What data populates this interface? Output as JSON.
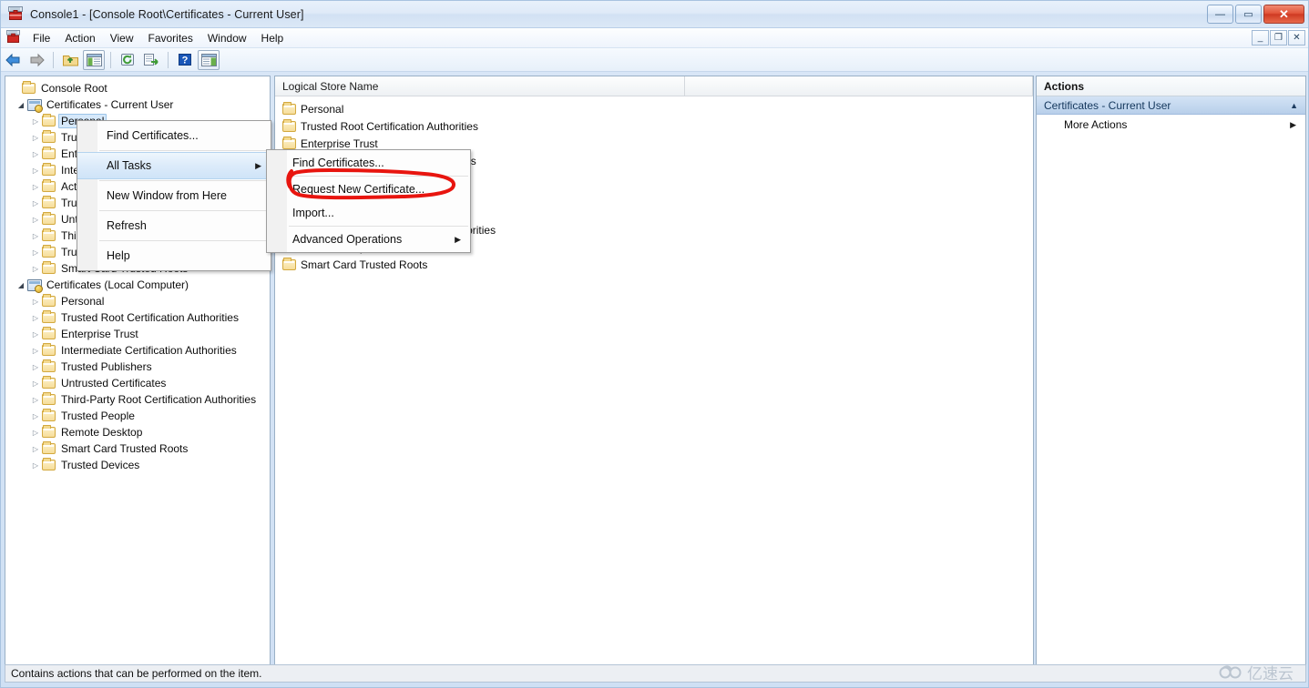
{
  "window": {
    "title": "Console1 - [Console Root\\Certificates - Current User]",
    "app_icon": "mmc-console-icon",
    "buttons": {
      "minimize": "—",
      "maximize": "▭",
      "close": "✕"
    },
    "mdi_buttons": {
      "minimize": "_",
      "restore": "❐",
      "close": "✕"
    }
  },
  "menubar": {
    "items": [
      {
        "label": "File"
      },
      {
        "label": "Action"
      },
      {
        "label": "View"
      },
      {
        "label": "Favorites"
      },
      {
        "label": "Window"
      },
      {
        "label": "Help"
      }
    ]
  },
  "toolbar": {
    "items": [
      {
        "name": "back-icon"
      },
      {
        "name": "forward-icon"
      },
      {
        "name": "up-folder-icon"
      },
      {
        "name": "show-hide-tree-icon"
      },
      {
        "name": "refresh-icon"
      },
      {
        "name": "export-list-icon"
      },
      {
        "name": "help-icon"
      },
      {
        "name": "show-hide-action-pane-icon"
      }
    ]
  },
  "tree": {
    "nodes": [
      {
        "label": "Console Root",
        "level": 0,
        "icon": "folder-icon",
        "twisty": "",
        "selected": false
      },
      {
        "label": "Certificates - Current User",
        "level": 1,
        "icon": "snapin-icon",
        "twisty": "open",
        "selected": false
      },
      {
        "label": "Personal",
        "level": 2,
        "icon": "folder-icon",
        "twisty": "closed",
        "selected": true
      },
      {
        "label": "Trusted Root Certification Authorities",
        "level": 2,
        "icon": "folder-icon",
        "twisty": "closed",
        "selected": false
      },
      {
        "label": "Enterprise Trust",
        "level": 2,
        "icon": "folder-icon",
        "twisty": "closed",
        "selected": false
      },
      {
        "label": "Intermediate Certification Authorities",
        "level": 2,
        "icon": "folder-icon",
        "twisty": "closed",
        "selected": false
      },
      {
        "label": "Active Directory User Object",
        "level": 2,
        "icon": "folder-icon",
        "twisty": "closed",
        "selected": false
      },
      {
        "label": "Trusted Publishers",
        "level": 2,
        "icon": "folder-icon",
        "twisty": "closed",
        "selected": false
      },
      {
        "label": "Untrusted Certificates",
        "level": 2,
        "icon": "folder-icon",
        "twisty": "closed",
        "selected": false
      },
      {
        "label": "Third-Party Root Certification Authorities",
        "level": 2,
        "icon": "folder-icon",
        "twisty": "closed",
        "selected": false
      },
      {
        "label": "Trusted People",
        "level": 2,
        "icon": "folder-icon",
        "twisty": "closed",
        "selected": false
      },
      {
        "label": "Smart Card Trusted Roots",
        "level": 2,
        "icon": "folder-icon",
        "twisty": "closed",
        "selected": false
      },
      {
        "label": "Certificates (Local Computer)",
        "level": 1,
        "icon": "snapin-icon",
        "twisty": "open",
        "selected": false
      },
      {
        "label": "Personal",
        "level": 2,
        "icon": "folder-icon",
        "twisty": "closed",
        "selected": false
      },
      {
        "label": "Trusted Root Certification Authorities",
        "level": 2,
        "icon": "folder-icon",
        "twisty": "closed",
        "selected": false
      },
      {
        "label": "Enterprise Trust",
        "level": 2,
        "icon": "folder-icon",
        "twisty": "closed",
        "selected": false
      },
      {
        "label": "Intermediate Certification Authorities",
        "level": 2,
        "icon": "folder-icon",
        "twisty": "closed",
        "selected": false
      },
      {
        "label": "Trusted Publishers",
        "level": 2,
        "icon": "folder-icon",
        "twisty": "closed",
        "selected": false
      },
      {
        "label": "Untrusted Certificates",
        "level": 2,
        "icon": "folder-icon",
        "twisty": "closed",
        "selected": false
      },
      {
        "label": "Third-Party Root Certification Authorities",
        "level": 2,
        "icon": "folder-icon",
        "twisty": "closed",
        "selected": false
      },
      {
        "label": "Trusted People",
        "level": 2,
        "icon": "folder-icon",
        "twisty": "closed",
        "selected": false
      },
      {
        "label": "Remote Desktop",
        "level": 2,
        "icon": "folder-icon",
        "twisty": "closed",
        "selected": false
      },
      {
        "label": "Smart Card Trusted Roots",
        "level": 2,
        "icon": "folder-icon",
        "twisty": "closed",
        "selected": false
      },
      {
        "label": "Trusted Devices",
        "level": 2,
        "icon": "folder-icon",
        "twisty": "closed",
        "selected": false
      }
    ]
  },
  "list": {
    "columns": [
      {
        "label": "Logical Store Name"
      },
      {
        "label": ""
      }
    ],
    "rows": [
      {
        "label": "Personal",
        "icon": "folder-icon"
      },
      {
        "label": "Trusted Root Certification Authorities",
        "icon": "folder-icon"
      },
      {
        "label": "Enterprise Trust",
        "icon": "folder-icon"
      },
      {
        "label": "Intermediate Certification Authorities",
        "icon": "folder-icon"
      },
      {
        "label": "Active Directory User Object",
        "icon": "folder-icon"
      },
      {
        "label": "Trusted Publishers",
        "icon": "folder-icon"
      },
      {
        "label": "Untrusted Certificates",
        "icon": "folder-icon"
      },
      {
        "label": "Third-Party Root Certification Authorities",
        "icon": "folder-icon"
      },
      {
        "label": "Trusted People",
        "icon": "folder-icon"
      },
      {
        "label": "Smart Card Trusted Roots",
        "icon": "folder-icon"
      }
    ]
  },
  "actions": {
    "title": "Actions",
    "group_label": "Certificates - Current User",
    "collapse_glyph": "▲",
    "items": [
      {
        "label": "More Actions",
        "submenu_glyph": "▶"
      }
    ]
  },
  "context_menu": {
    "items": [
      {
        "label": "Find Certificates...",
        "selected": false,
        "submenu": false
      },
      {
        "label": "All Tasks",
        "selected": true,
        "submenu": true,
        "submenu_glyph": "▶"
      },
      {
        "label": "New Window from Here",
        "selected": false,
        "submenu": false
      },
      {
        "label": "Refresh",
        "selected": false,
        "submenu": false
      },
      {
        "label": "Help",
        "selected": false,
        "submenu": false
      }
    ]
  },
  "submenu": {
    "items": [
      {
        "label": "Find Certificates...",
        "submenu": false
      },
      {
        "label": "Request New Certificate...",
        "submenu": false
      },
      {
        "label": "Import...",
        "submenu": false
      },
      {
        "label": "Advanced Operations",
        "submenu": true,
        "submenu_glyph": "▶"
      }
    ]
  },
  "annotation": {
    "target": "Request New Certificate...",
    "color": "#e8150f",
    "shape": "hand-drawn-ellipse"
  },
  "statusbar": {
    "text": "Contains actions that can be performed on the item."
  },
  "watermark": {
    "text": "亿速云"
  }
}
